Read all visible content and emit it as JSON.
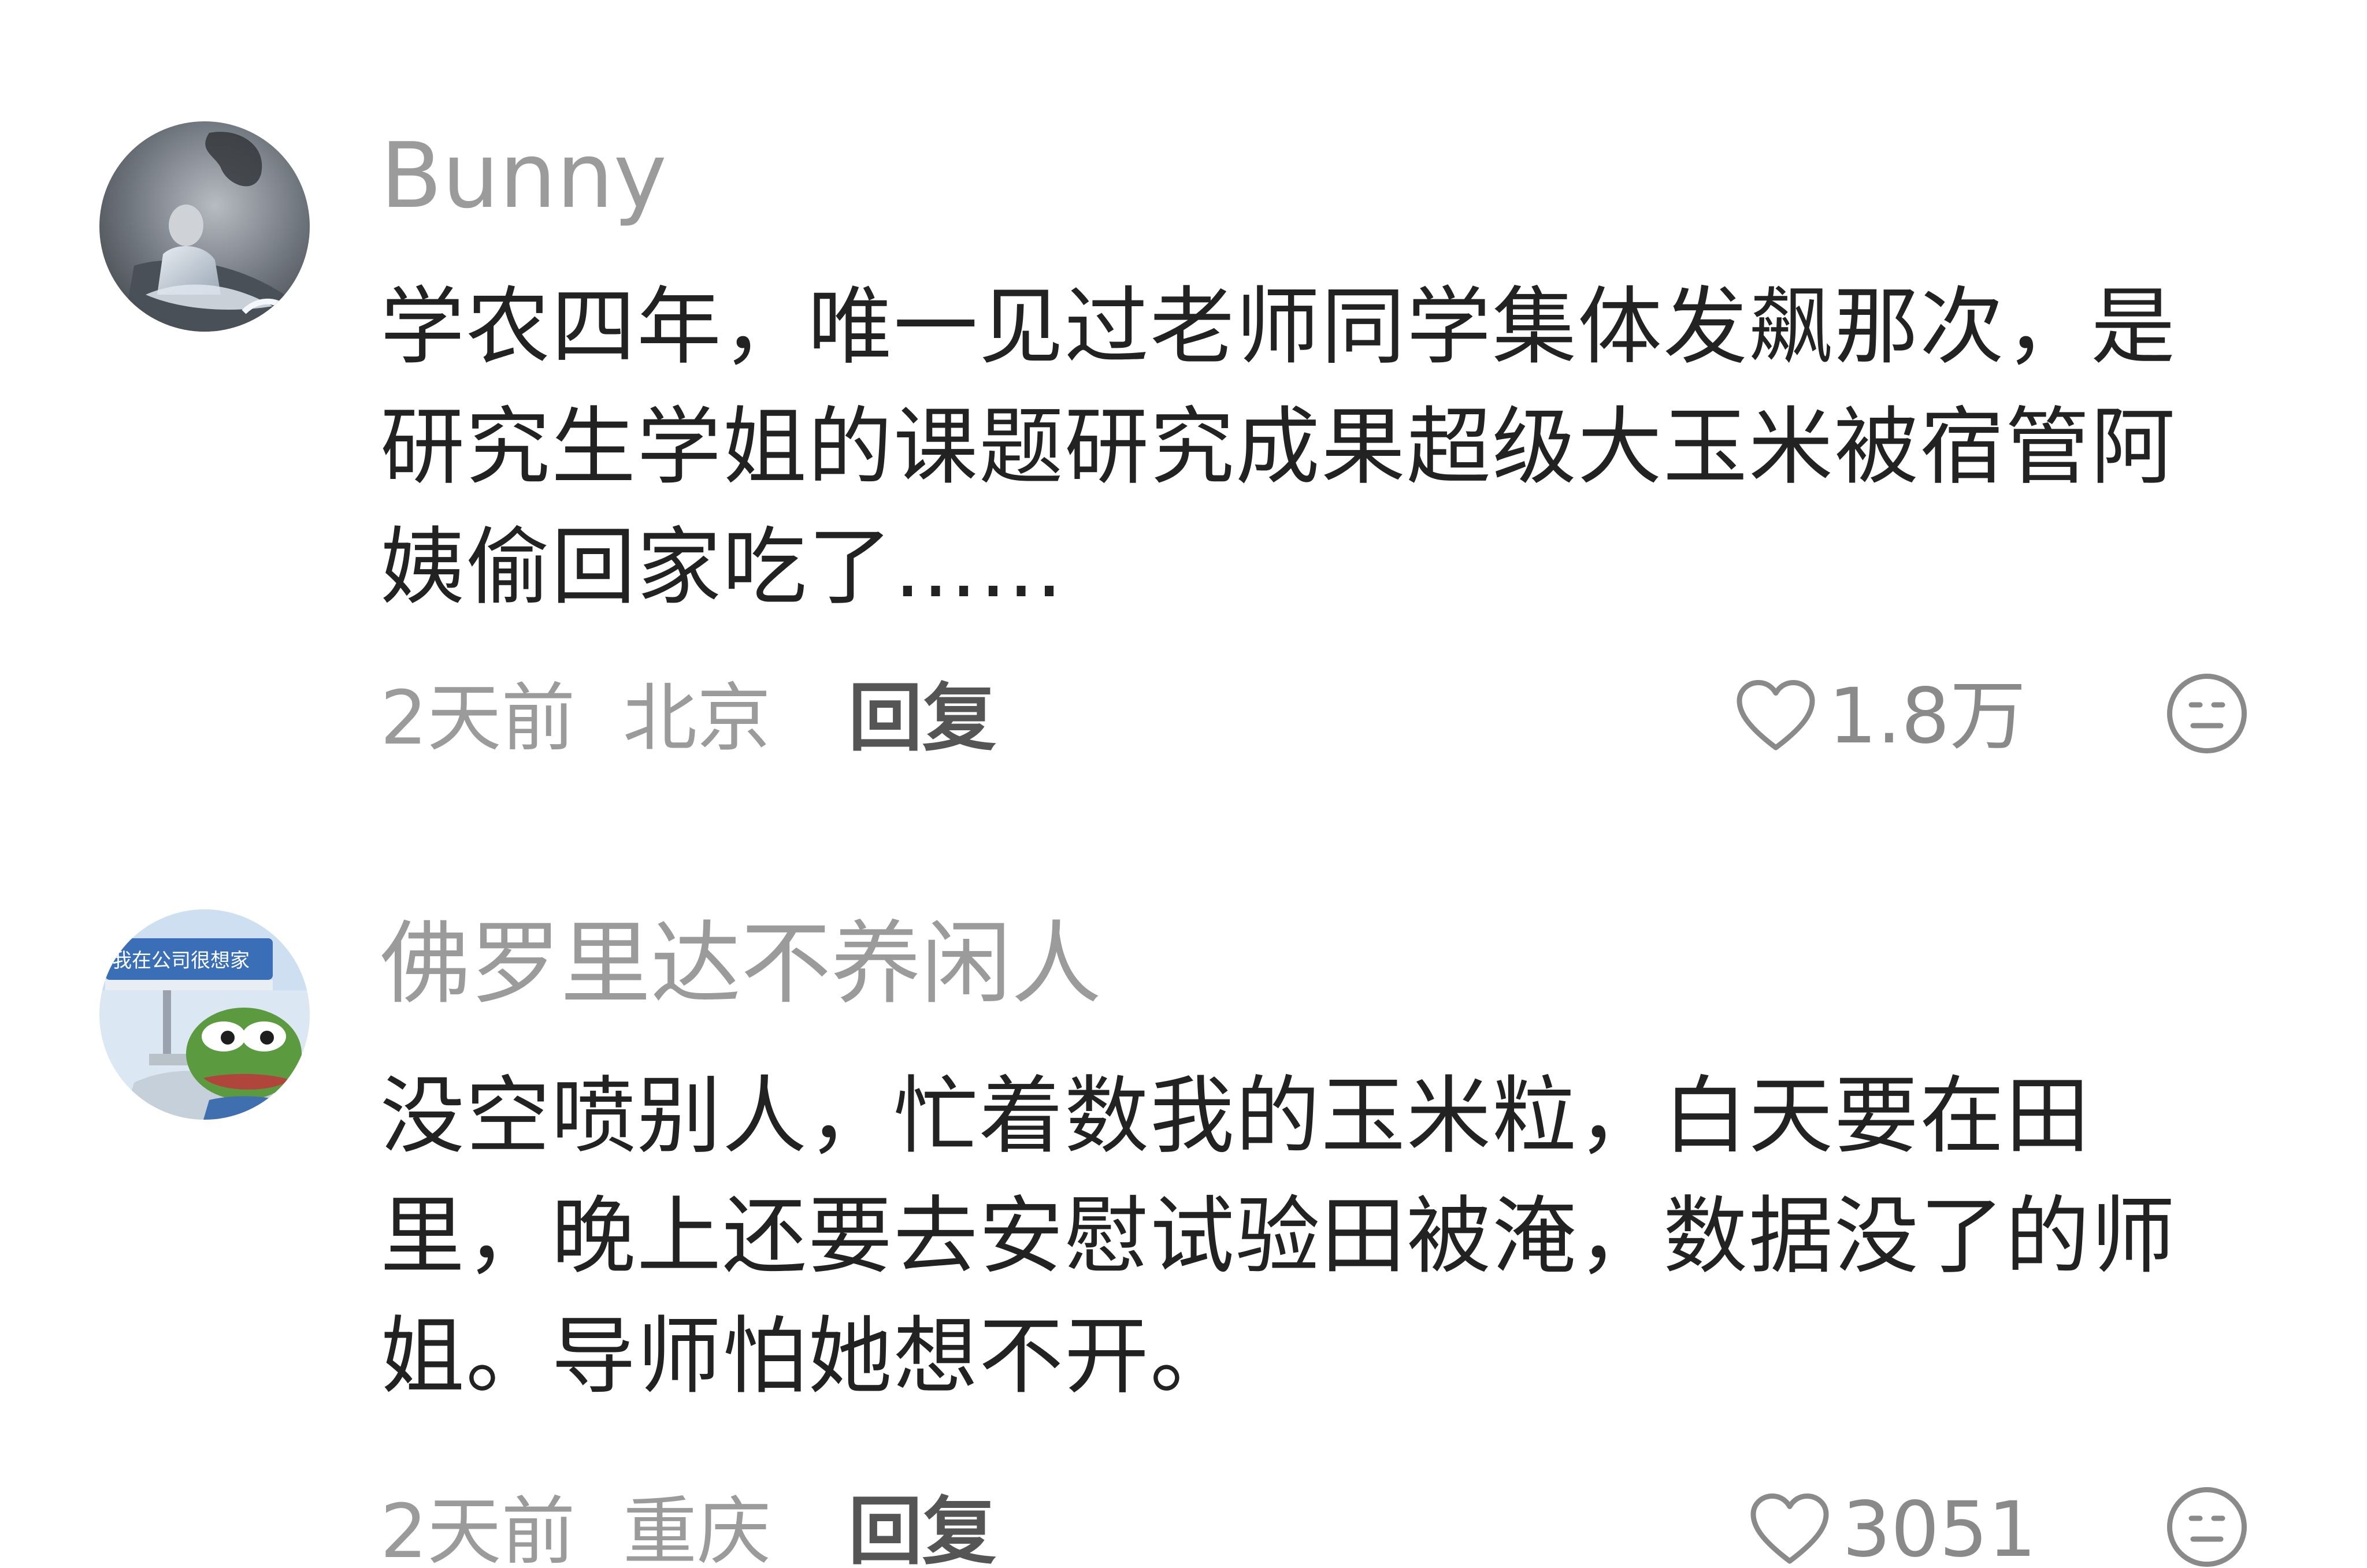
{
  "comments": [
    {
      "username": "Bunny",
      "avatar_icon": "user-photo-avatar",
      "text": "学农四年，唯一见过老师同学集体发飙那次，是研究生学姐的课题研究成果超级大玉米被宿管阿姨偷回家吃了……",
      "time": "2天前",
      "location": "北京",
      "reply_label": "回复",
      "likes": "1.8万",
      "like_icon": "heart-outline-icon",
      "dislike_icon": "meh-face-icon"
    },
    {
      "username": "佛罗里达不养闲人",
      "avatar_icon": "pepe-frog-avatar",
      "avatar_sign_text": "我在公司很想家",
      "text": "没空喷别人，忙着数我的玉米粒，白天要在田里，晚上还要去安慰试验田被淹，数据没了的师姐。导师怕她想不开。",
      "time": "2天前",
      "location": "重庆",
      "reply_label": "回复",
      "likes": "3051",
      "like_icon": "heart-outline-icon",
      "dislike_icon": "meh-face-icon"
    }
  ],
  "colors": {
    "background": "#ffffff",
    "username": "#9b9b9b",
    "body_text": "#222222",
    "meta_text": "#9b9b9b",
    "reply_text": "#555555",
    "icon_stroke": "#8a8a8a"
  }
}
